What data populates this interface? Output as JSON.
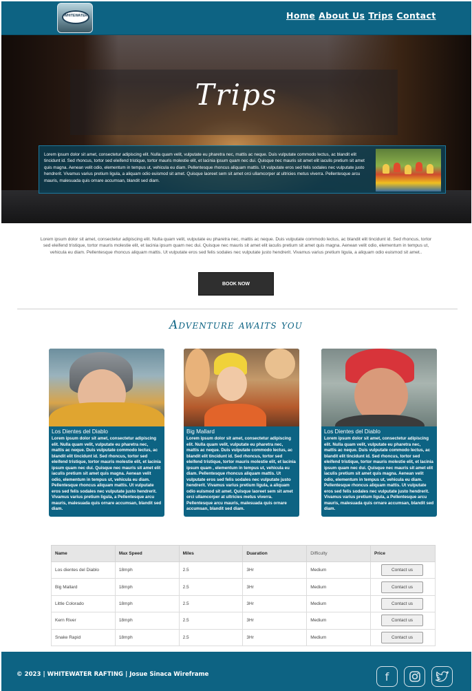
{
  "header": {
    "logo_text": "WHITEWATER",
    "nav": [
      "Home",
      "About Us",
      "Trips",
      "Contact"
    ]
  },
  "hero": {
    "title": "Trips",
    "text": "Lorem ipsum dolor sit amet, consectetur adipiscing elit. Nulla quam velit, vulputate eu pharetra nec, mattis ac neque. Duis vulputate commodo lectus, ac blandit elit tincidunt id. Sed rhoncus, tortor sed eleifend tristique, tortor mauris molestie elit, et lacinia ipsum quam nec dui. Quisque nec mauris sit amet elit iaculis pretium sit amet quis magna. Aenean velit odio, elementum in tempus ut, vehicula eu diam. Pellentesque rhoncus aliquam mattis. Ut vulputate eros sed felis sodales nec vulputate justo hendrerit. Vivamus varius pretium ligula, a aliquam odio euismod sit amet. Quisque laoreet sem sit amet orci ullamcorper at ultricies metus viverra. Pellentesque arcu mauris, malesuada quis ornare accumsan, blandit sed diam."
  },
  "intro": {
    "text": "Lorem ipsum dolor sit amet, consectetur adipiscing elit. Nulla quam velit, vulputate eu pharetra nec, mattis ac neque. Duis vulputate commodo lectus, ac blandit elit tincidunt id. Sed rhoncus, tortor sed eleifend tristique, tortor mauris molestie elit, et lacinia ipsum quam nec dui. Quisque nec mauris sit amet elit iaculis pretium sit amet quis magna. Aenean velit odio, elementum in tempus ut, vehicula eu diam. Pellentesque rhoncus aliquam mattis. Ut vulputate eros sed felis sodales nec vulputate justo hendrerit. Vivamus varius pretium ligula, a aliquam odio euismod sit amet..",
    "button": "BOOK NOW"
  },
  "tagline": "Adventure awaits you",
  "cards": [
    {
      "title": "Los Dientes del Diablo",
      "text": "Lorem ipsum dolor sit amet, consectetur adipiscing elit. Nulla quam velit, vulputate eu pharetra nec, mattis ac neque. Duis vulputate commodo lectus, ac blandit elit tincidunt id. Sed rhoncus, tortor sed eleifend tristique, tortor mauris molestie elit, et lacinia ipsum quam nec dui. Quisque nec mauris sit amet elit iaculis pretium sit amet quis magna. Aenean velit odio, elementum in tempus ut, vehicula eu diam. Pellentesque rhoncus aliquam mattis. Ut vulputate eros sed felis sodales nec vulputate justo hendrerit. Vivamus varius pretium ligula, a Pellentesque arcu mauris, malesuada quis ornare accumsan, blandit sed diam."
    },
    {
      "title": "Big Mallard",
      "text": "Lorem ipsum dolor sit amet, consectetur adipiscing elit. Nulla quam velit, vulputate eu pharetra nec, mattis ac neque. Duis vulputate commodo lectus, ac blandit elit tincidunt id. Sed rhoncus, tortor sed eleifend tristique, tortor mauris molestie elit, et lacinia ipsum quam , elementum in tempus ut, vehicula eu diam. Pellentesque rhoncus aliquam mattis. Ut vulputate eros sed felis sodales nec vulputate justo hendrerit. Vivamus varius pretium ligula, a aliquam odio euismod sit amet. Quisque laoreet sem sit amet orci ullamcorper at ultricies metus viverra. Pellentesque arcu mauris, malesuada quis ornare accumsan, blandit sed diam."
    },
    {
      "title": "Los Dientes del Diablo",
      "text": "Lorem ipsum dolor sit amet, consectetur adipiscing elit. Nulla quam velit, vulputate eu pharetra nec, mattis ac neque. Duis vulputate commodo lectus, ac blandit elit tincidunt id. Sed rhoncus, tortor sed eleifend tristique, tortor mauris molestie elit, et lacinia ipsum quam nec dui. Quisque nec mauris sit amet elit iaculis pretium sit amet quis magna. Aenean velit odio, elementum in tempus ut, vehicula eu diam. Pellentesque rhoncus aliquam mattis. Ut vulputate eros sed felis sodales nec vulputate justo hendrerit. Vivamus varius pretium ligula, a Pellentesque arcu mauris, malesuada quis ornare accumsan, blandit sed diam."
    }
  ],
  "table": {
    "headers": [
      "Name",
      "Max Speed",
      "Miles",
      "Duaration",
      "Difficulty",
      "Price"
    ],
    "rows": [
      [
        "Los dientes del Diablo",
        "18mph",
        "2.5",
        "3Hr",
        "Medium",
        "Contact us"
      ],
      [
        "Big Mallard",
        "18mph",
        "2.5",
        "3Hr",
        "Medium",
        "Contact us"
      ],
      [
        "Little Colorado",
        "18mph",
        "2.5",
        "3Hr",
        "Medium",
        "Contact us"
      ],
      [
        "Kern River",
        "18mph",
        "2.5",
        "3Hr",
        "Medium",
        "Contact us"
      ],
      [
        "Snake Rapid",
        "18mph",
        "2.5",
        "3Hr",
        "Medium",
        "Contact us"
      ]
    ]
  },
  "footer": {
    "text": "© 2023 | WHITEWATER RAFTING | Josue Sinaca Wireframe",
    "icons": [
      "facebook-icon",
      "instagram-icon",
      "twitter-icon"
    ]
  },
  "colors": {
    "brand": "#0d6383",
    "button_dark": "#2f2f2f"
  }
}
